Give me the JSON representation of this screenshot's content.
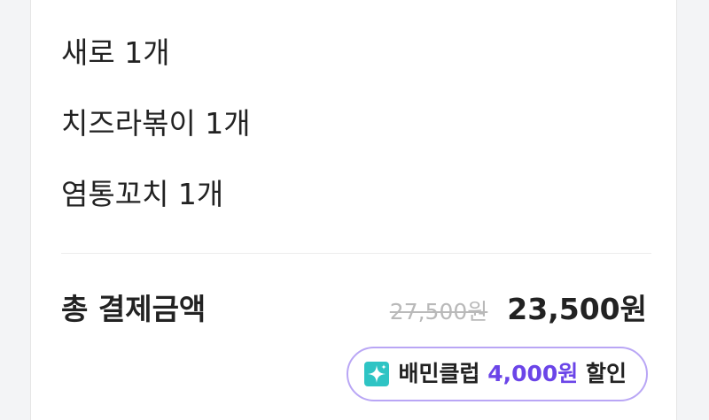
{
  "order_items": [
    {
      "label": "새로 1개"
    },
    {
      "label": "치즈라볶이 1개"
    },
    {
      "label": "염통꼬치 1개"
    }
  ],
  "total": {
    "label": "총 결제금액",
    "original_price": "27,500원",
    "final_price": "23,500원"
  },
  "club_discount": {
    "icon": "sparkle-icon",
    "name": "배민클럽",
    "amount": "4,000원",
    "suffix": "할인",
    "accent_color": "#6b45e8",
    "icon_color": "#2ec4c4"
  }
}
